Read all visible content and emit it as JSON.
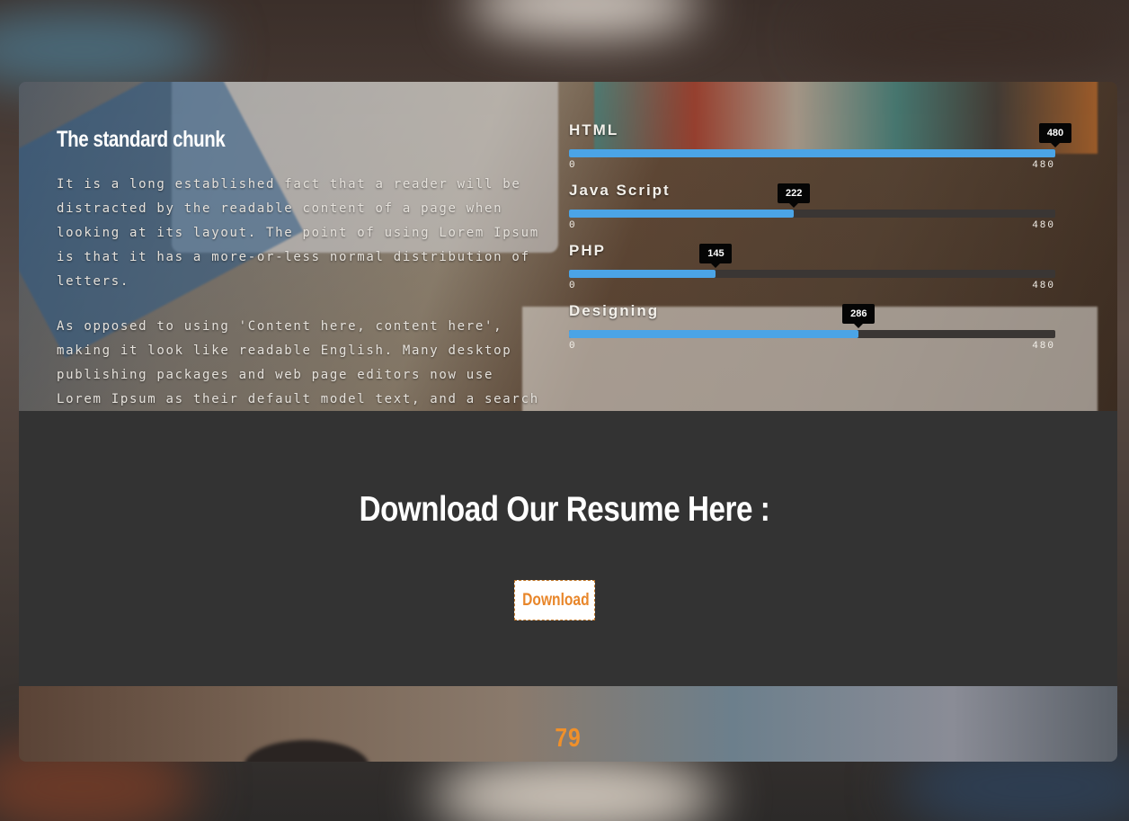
{
  "skills_section": {
    "title": "The standard chunk",
    "paragraphs": [
      "It is a long established fact that a reader will be distracted by the readable content of a page when looking at its layout. The point of using Lorem Ipsum is that it has a more-or-less normal distribution of letters.",
      "As opposed to using 'Content here, content here', making it look like readable English. Many desktop publishing packages and web page editors now use Lorem Ipsum as their default model text, and a search of lorem ipsum"
    ],
    "bars": [
      {
        "label": "HTML",
        "value": 480,
        "value_label": "480",
        "min_label": "0",
        "max_label": "480"
      },
      {
        "label": "Java Script",
        "value": 222,
        "value_label": "222",
        "min_label": "0",
        "max_label": "480"
      },
      {
        "label": "PHP",
        "value": 145,
        "value_label": "145",
        "min_label": "0",
        "max_label": "480"
      },
      {
        "label": "Designing",
        "value": 286,
        "value_label": "286",
        "min_label": "0",
        "max_label": "480"
      }
    ],
    "max_value": 480,
    "bar_color": "#4ba4e6"
  },
  "download_section": {
    "title": "Download Our Resume Here :",
    "button_label": "Download",
    "button_text_color": "#e8862a"
  },
  "counter": {
    "value": "79",
    "color": "#f0902a"
  }
}
